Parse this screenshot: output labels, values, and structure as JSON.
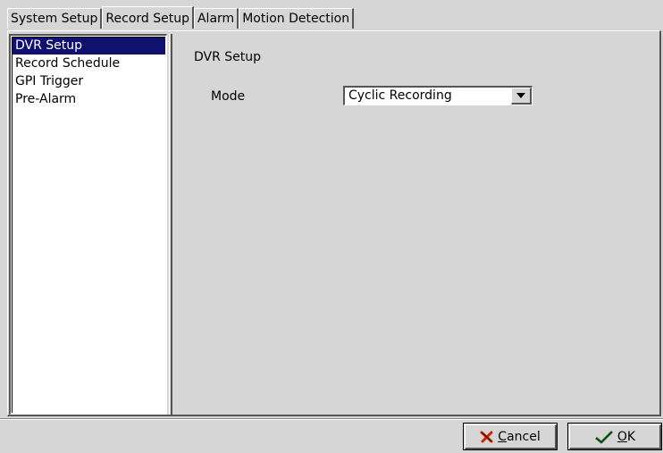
{
  "tabs": [
    {
      "label": "System Setup"
    },
    {
      "label": "Record Setup",
      "active": true
    },
    {
      "label": "Alarm"
    },
    {
      "label": "Motion Detection"
    }
  ],
  "sidebar": {
    "items": [
      {
        "label": "DVR Setup",
        "selected": true
      },
      {
        "label": "Record Schedule"
      },
      {
        "label": "GPI Trigger"
      },
      {
        "label": "Pre-Alarm"
      }
    ]
  },
  "main": {
    "section_title": "DVR Setup",
    "mode": {
      "label": "Mode",
      "value": "Cyclic Recording",
      "icon": "chevron-down-icon"
    }
  },
  "buttons": {
    "cancel": {
      "label_prefix": "",
      "mnemonic": "C",
      "label_rest": "ancel",
      "icon": "cancel-x-icon",
      "icon_color": "#cc2200"
    },
    "ok": {
      "mnemonic": "O",
      "label_rest": "K",
      "icon": "checkmark-icon",
      "icon_color": "#2e7d32"
    }
  },
  "colors": {
    "selection": "#10106e",
    "background": "#d6d6d6"
  }
}
